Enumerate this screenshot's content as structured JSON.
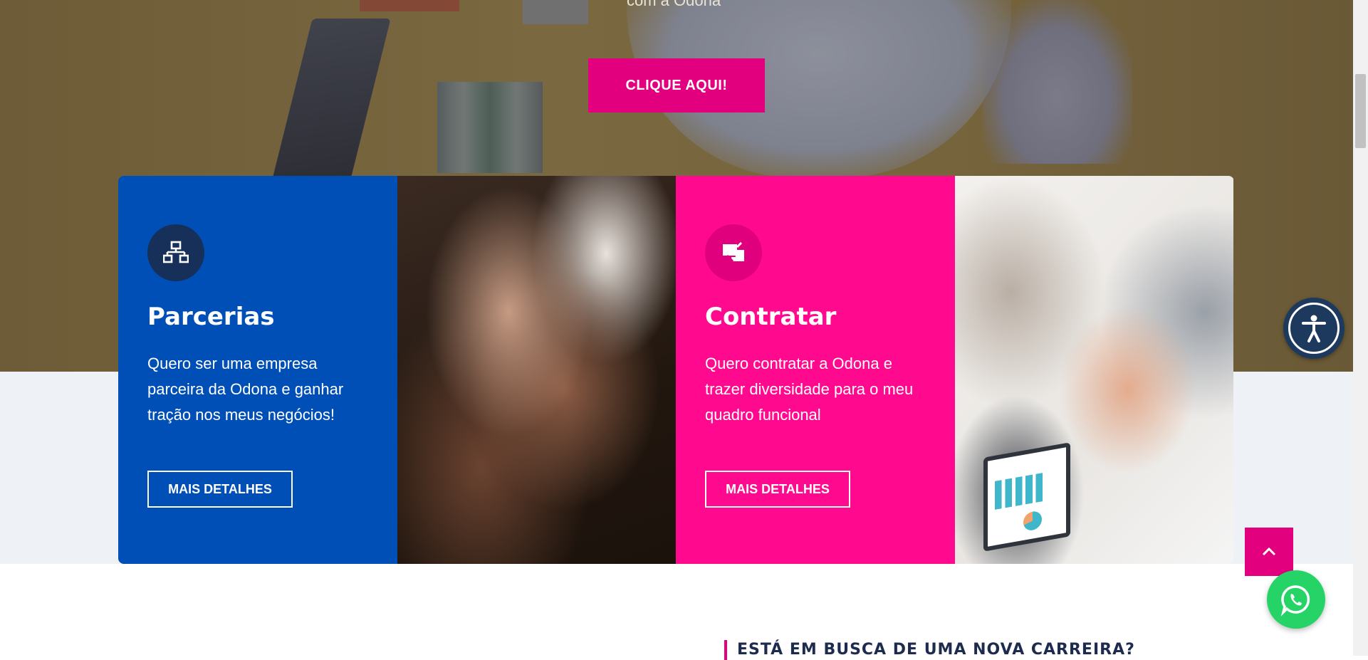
{
  "hero": {
    "caption": "com a Odona",
    "cta_label": "CLIQUE AQUI!"
  },
  "cards": [
    {
      "title": "Parcerias",
      "text": "Quero ser uma empresa parceira da Odona e ganhar tração nos meus negócios!",
      "button_label": "MAIS DETALHES",
      "icon": "network-icon",
      "color": "#004fb6"
    },
    {
      "title": "Contratar",
      "text": "Quero contratar a Odona e trazer diversidade para o meu quadro funcional",
      "button_label": "MAIS DETALHES",
      "icon": "hire-icon",
      "color": "#ff0a8f"
    }
  ],
  "next_section": {
    "heading": "ESTÁ EM BUSCA DE UMA NOVA CARREIRA?"
  },
  "colors": {
    "accent_pink": "#e3007f",
    "card_blue": "#004fb6",
    "card_pink": "#ff0a8f",
    "whatsapp_green": "#25d366",
    "accessibility_navy": "#1d3a5e"
  },
  "widgets": {
    "accessibility_icon": "accessibility-icon",
    "back_to_top_icon": "chevron-up-icon",
    "whatsapp_icon": "whatsapp-icon"
  }
}
